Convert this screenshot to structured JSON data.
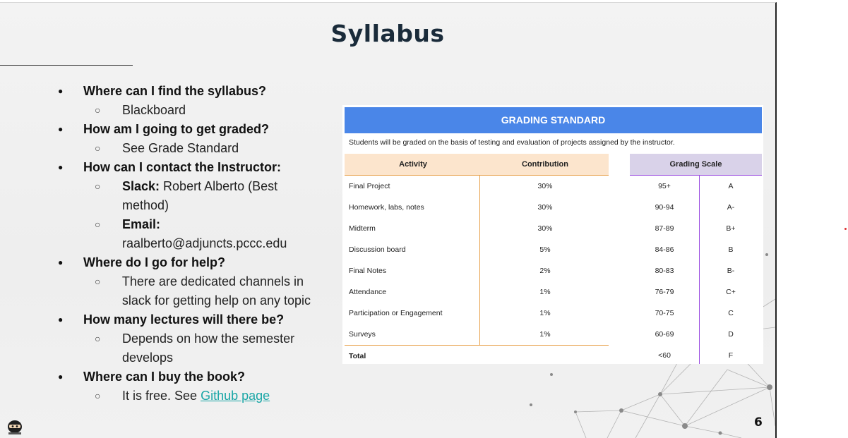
{
  "slide": {
    "title": "Syllabus",
    "page_number": "6",
    "logo_icon": "ninja-mascot-icon"
  },
  "faq": [
    {
      "question": "Where can I find the syllabus?",
      "answers": [
        {
          "label": "",
          "text": "Blackboard"
        }
      ]
    },
    {
      "question": "How am I going to get graded?",
      "answers": [
        {
          "label": "",
          "text": "See Grade Standard"
        }
      ]
    },
    {
      "question": "How can I contact the Instructor:",
      "answers": [
        {
          "label": "Slack:",
          "text": " Robert Alberto (Best method)"
        },
        {
          "label": "Email:",
          "text": " raalberto@adjuncts.pccc.edu"
        }
      ]
    },
    {
      "question": "Where do I go for help?",
      "answers": [
        {
          "label": "",
          "text": "There are dedicated channels in slack for getting help on any topic"
        }
      ]
    },
    {
      "question": "How many lectures will there be?",
      "answers": [
        {
          "label": "",
          "text": "Depends on how the semester develops"
        }
      ]
    },
    {
      "question": "Where can I buy the book?",
      "answers": [
        {
          "label": "",
          "text": "It is free. See ",
          "link": "Github page"
        }
      ]
    }
  ],
  "grading": {
    "title": "GRADING STANDARD",
    "description": "Students will be graded on the basis of testing and evaluation of projects assigned by the instructor.",
    "activity_header": "Activity",
    "contribution_header": "Contribution",
    "scale_header": "Grading Scale",
    "activities": [
      {
        "activity": "Final Project",
        "contribution": "30%"
      },
      {
        "activity": "Homework, labs, notes",
        "contribution": "30%"
      },
      {
        "activity": "Midterm",
        "contribution": "30%"
      },
      {
        "activity": "Discussion board",
        "contribution": "5%"
      },
      {
        "activity": "Final Notes",
        "contribution": "2%"
      },
      {
        "activity": "Attendance",
        "contribution": "1%"
      },
      {
        "activity": "Participation or Engagement",
        "contribution": "1%"
      },
      {
        "activity": "Surveys",
        "contribution": "1%"
      }
    ],
    "total_label": "Total",
    "scale": [
      {
        "range": "95+",
        "grade": "A"
      },
      {
        "range": "90-94",
        "grade": "A-"
      },
      {
        "range": "87-89",
        "grade": "B+"
      },
      {
        "range": "84-86",
        "grade": "B"
      },
      {
        "range": "80-83",
        "grade": "B-"
      },
      {
        "range": "76-79",
        "grade": "C+"
      },
      {
        "range": "70-75",
        "grade": "C"
      },
      {
        "range": "60-69",
        "grade": "D"
      },
      {
        "range": "<60",
        "grade": "F"
      }
    ],
    "colors": {
      "header": "#4a86e8",
      "activity_header_bg": "#fce5cd",
      "scale_header_bg": "#d9d2e9",
      "activity_line": "#e8a04a",
      "scale_line": "#9b4de0"
    }
  }
}
